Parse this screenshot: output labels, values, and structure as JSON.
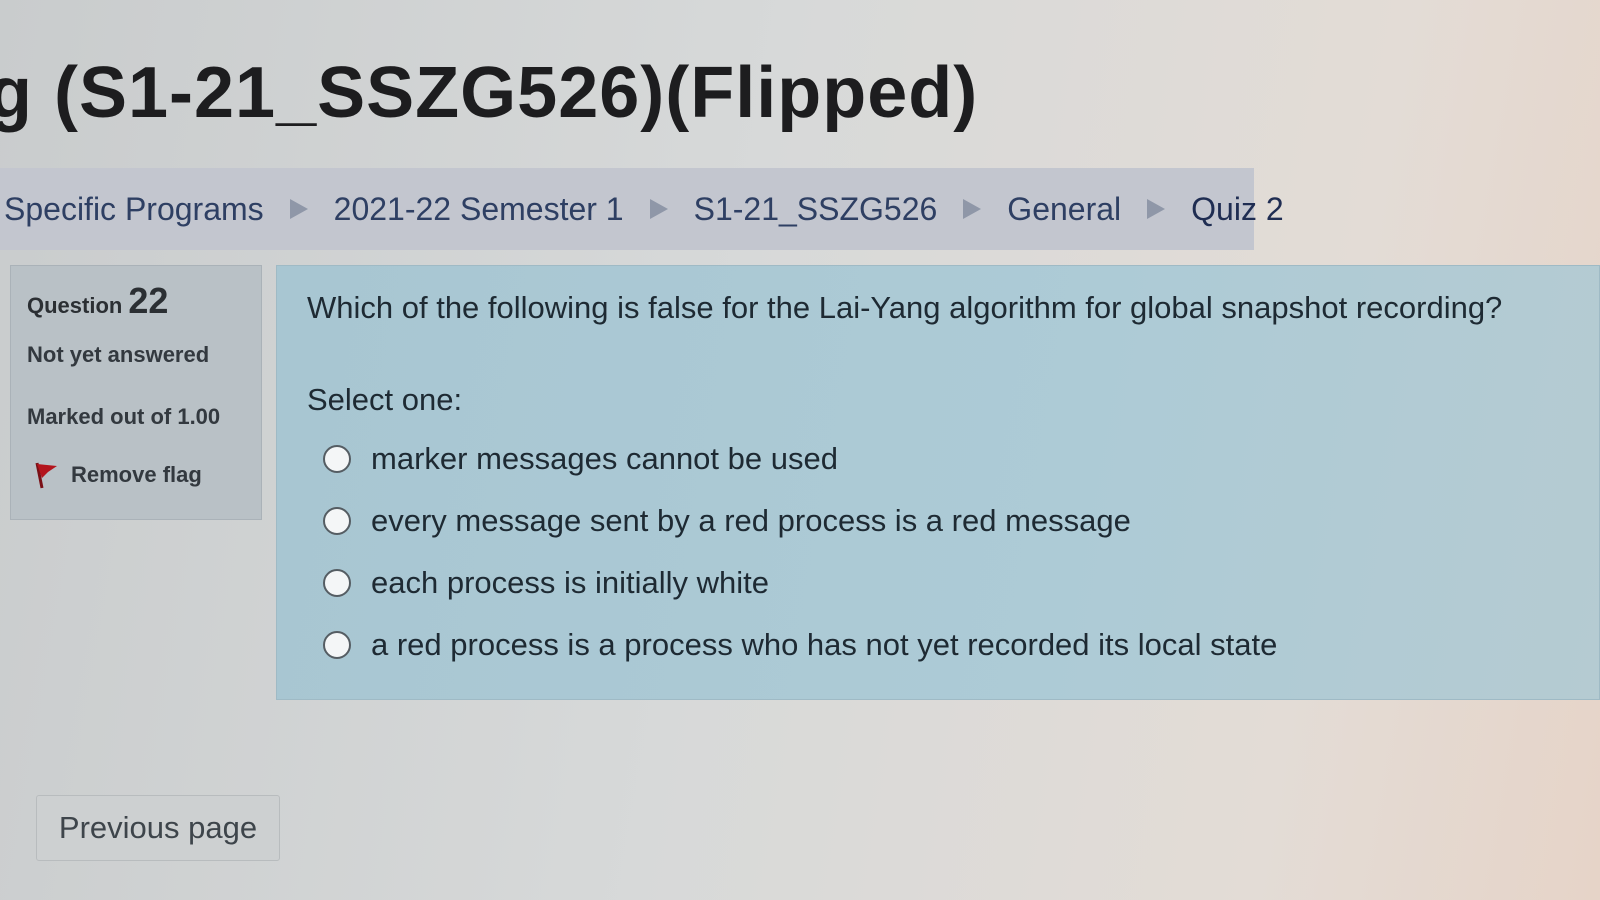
{
  "header": {
    "title": "g (S1-21_SSZG526)(Flipped)"
  },
  "breadcrumb": [
    {
      "label": "Specific Programs"
    },
    {
      "label": "2021-22 Semester 1"
    },
    {
      "label": "S1-21_SSZG526"
    },
    {
      "label": "General"
    },
    {
      "label": "Quiz 2"
    }
  ],
  "question_info": {
    "label": "Question",
    "number": "22",
    "state": "Not yet answered",
    "grade": "Marked out of 1.00",
    "flag_label": "Remove flag",
    "flag_icon": "flag-icon",
    "flag_color": "#b3141c"
  },
  "question": {
    "text": "Which of the following is false for the Lai-Yang algorithm for global snapshot recording?",
    "prompt": "Select one:",
    "options": [
      {
        "label": "marker messages cannot be used"
      },
      {
        "label": "every message sent by a red process is a red message"
      },
      {
        "label": "each process is initially white"
      },
      {
        "label": "a red process is a process who has not yet recorded its local state"
      }
    ]
  },
  "navigation": {
    "previous_label": "Previous page"
  }
}
